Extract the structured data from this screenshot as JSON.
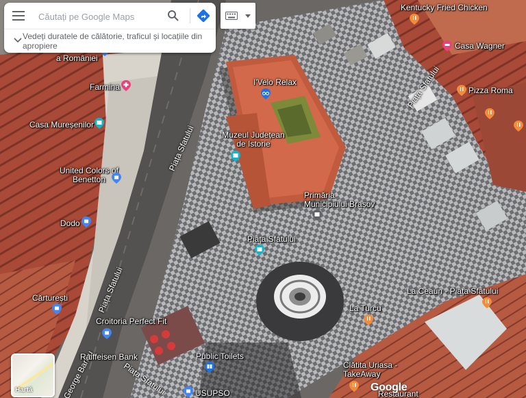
{
  "search": {
    "placeholder": "Căutați pe Google Maps",
    "suggestion": "Vedeți duratele de călătorie, traficul și locațiile din apropiere"
  },
  "icons": {
    "menu": "hamburger-menu-icon",
    "search": "search-icon",
    "directions": "directions-icon",
    "keyboard": "keyboard-icon",
    "dropdown": "chevron-down-icon"
  },
  "colors": {
    "directions_blue": "#1a73e8",
    "museum_teal": "#12b5cb",
    "shop_blue": "#4285f4",
    "food_orange": "#f28b3a",
    "poi_pink": "#ec407a"
  },
  "places": {
    "kfc": "Kentucky Fried Chicken",
    "casa_wagner": "Casa Wagner",
    "pizza_roma": "Pizza Roma",
    "velo_relax": "I'Velo Relax",
    "romaniei": "a României",
    "farmina": "Farmina",
    "casa_muresenilor": "Casa Mureșenilor",
    "museum": "Muzeul Județean de Istorie",
    "benetton": "United Colors of Benetton",
    "primaria": "Primăria Municipiului Brașov",
    "dodo": "Dodo",
    "piata_sfatului": "Piața Sfatului",
    "carturesti": "Cărturești",
    "la_ceaun": "La Ceaun - Piața Sfatului",
    "la_turcu": "La Turcu",
    "croitoria": "Croitoria Perfect Fit",
    "raiffeisen": "Raiffeisen Bank",
    "public_toilets": "Public Toilets",
    "clatita": "Clătita Uriasa - TakeAway",
    "usupso": "USUPSO",
    "restaurant": "Restaurant"
  },
  "streets": {
    "piata_sfatului_1": "Piața Sfatului",
    "piata_sfatului_2": "Piața Sfatului",
    "piata_sfatului_3": "Piața Sfatului",
    "piata_sfatului_4": "Piața Sfatului",
    "george_baritiu": "George Barițiu"
  },
  "layer_toggle": {
    "label": "Hartă"
  },
  "branding": {
    "logo": "Google"
  }
}
